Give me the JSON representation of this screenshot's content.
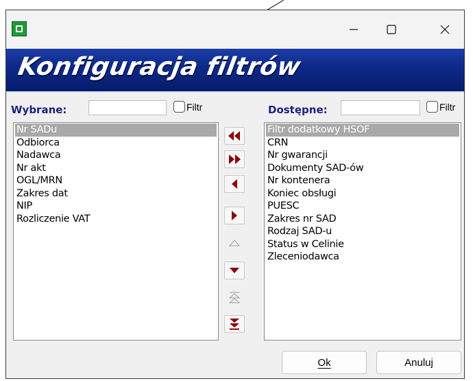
{
  "window": {
    "title": "",
    "minimize_icon": "minimize-icon",
    "maximize_icon": "maximize-icon",
    "close_icon": "close-icon"
  },
  "banner": {
    "title": "Konfiguracja filtrów"
  },
  "left_panel": {
    "label": "Wybrane:",
    "search_value": "",
    "filter_label": "Filtr",
    "items": [
      "Nr SADu",
      "Odbiorca",
      "Nadawca",
      "Nr akt",
      "OGL/MRN",
      "Zakres dat",
      "NIP",
      "Rozliczenie VAT"
    ],
    "selected_index": 0
  },
  "right_panel": {
    "label": "Dostępne:",
    "search_value": "",
    "filter_label": "Filtr",
    "items": [
      "Filtr dodatkowy HSOF",
      "CRN",
      "Nr gwarancji",
      "Dokumenty SAD-ów",
      "Nr kontenera",
      "Koniec obsługi",
      "PUESC",
      "Zakres nr SAD",
      "Rodzaj SAD-u",
      "Status w Celinie",
      "Zleceniodawca"
    ],
    "selected_index": 0
  },
  "transfer_buttons": [
    {
      "icon": "move-all-left-icon",
      "enabled": true
    },
    {
      "icon": "move-all-right-icon",
      "enabled": true
    },
    {
      "icon": "move-left-icon",
      "enabled": true
    },
    {
      "icon": "move-right-icon",
      "enabled": true
    },
    {
      "icon": "move-up-icon",
      "enabled": false
    },
    {
      "icon": "move-down-icon",
      "enabled": true
    },
    {
      "icon": "move-to-top-icon",
      "enabled": false
    },
    {
      "icon": "move-to-bottom-icon",
      "enabled": true
    }
  ],
  "buttons": {
    "ok_label": "Ok",
    "cancel_label": "Anuluj"
  },
  "colors": {
    "accent": "#8b0000",
    "banner": "#0d2a8a",
    "label": "#1a237e",
    "selection": "#a9a9a9"
  }
}
